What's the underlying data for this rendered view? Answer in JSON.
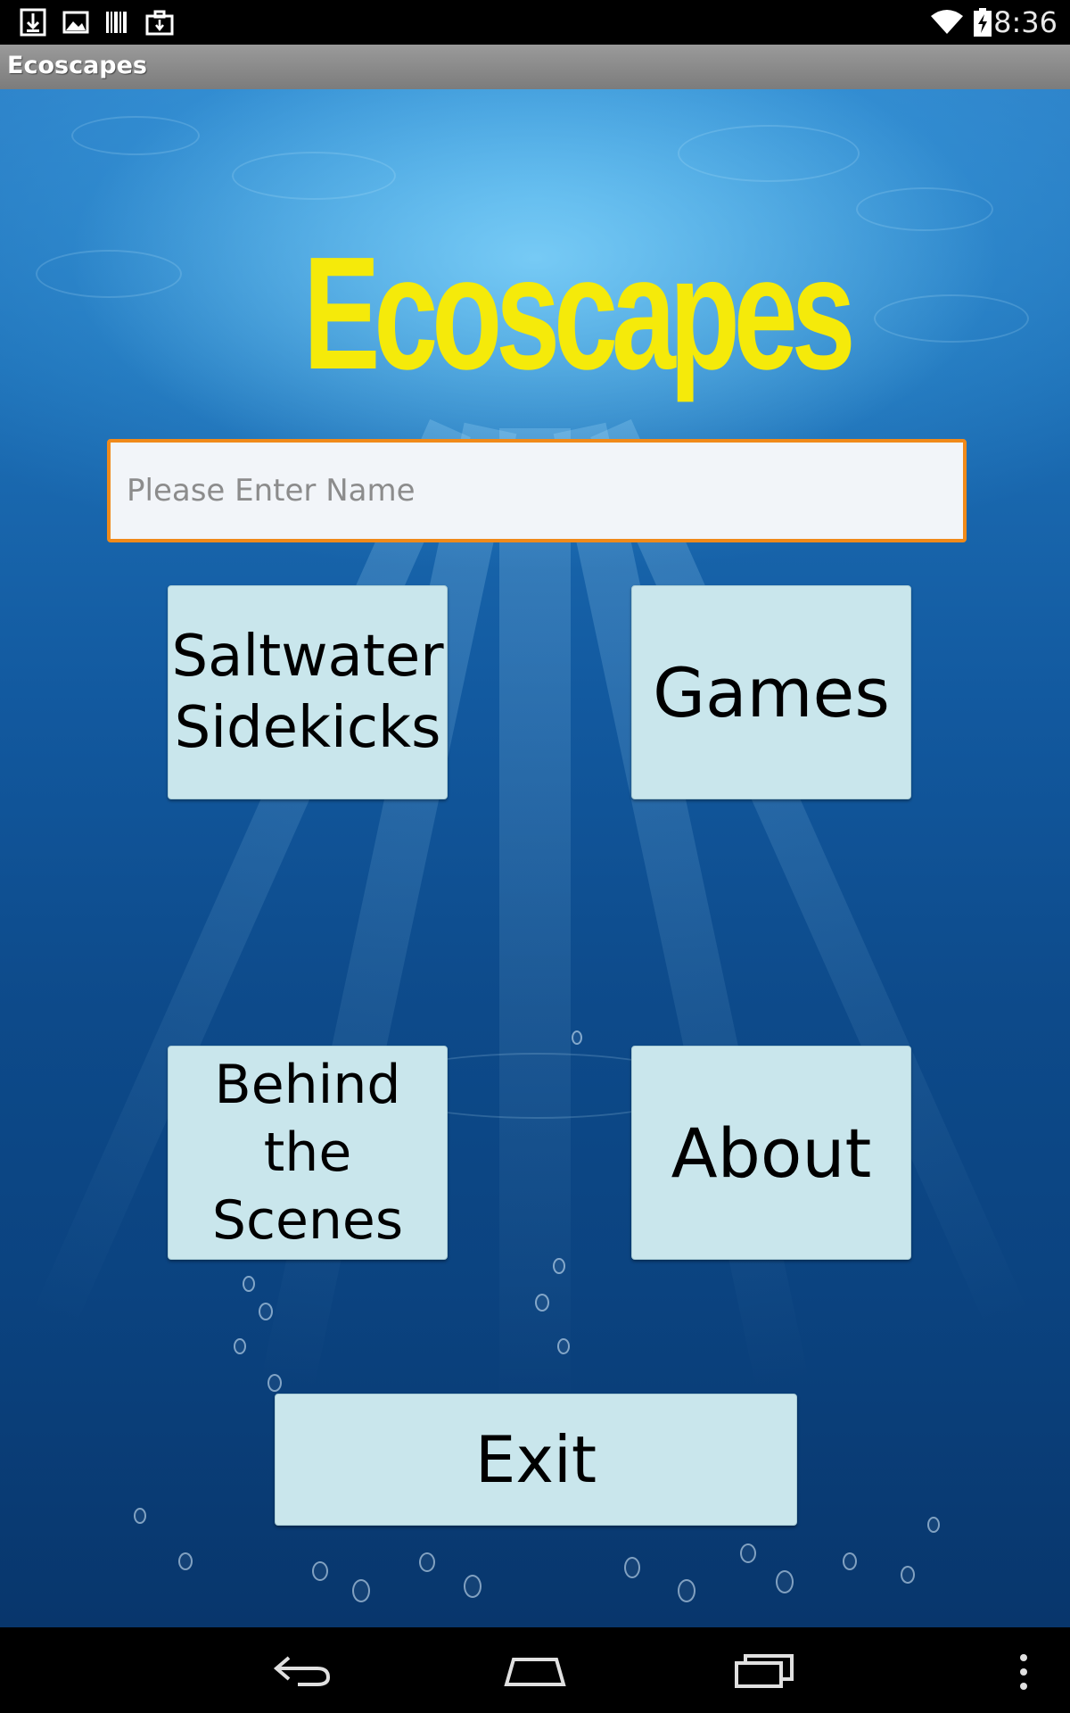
{
  "status_bar": {
    "time": "8:36",
    "icons": [
      "download-icon",
      "image-icon",
      "barcode-icon",
      "briefcase-icon",
      "wifi-icon",
      "battery-charging-icon"
    ]
  },
  "action_bar": {
    "title": "Ecoscapes"
  },
  "main": {
    "logo_text": "Ecoscapes",
    "name_input": {
      "value": "",
      "placeholder": "Please Enter Name"
    },
    "buttons": {
      "saltwater_sidekicks": "Saltwater\nSidekicks",
      "games": "Games",
      "behind_the_scenes": "Behind the\nScenes",
      "about": "About",
      "exit": "Exit"
    },
    "colors": {
      "logo": "#f5ea0a",
      "button_bg": "#c9e6ec",
      "input_border": "#f08a1a"
    }
  },
  "nav_bar": {
    "icons": [
      "back-icon",
      "home-icon",
      "recent-apps-icon",
      "overflow-menu-icon"
    ]
  }
}
